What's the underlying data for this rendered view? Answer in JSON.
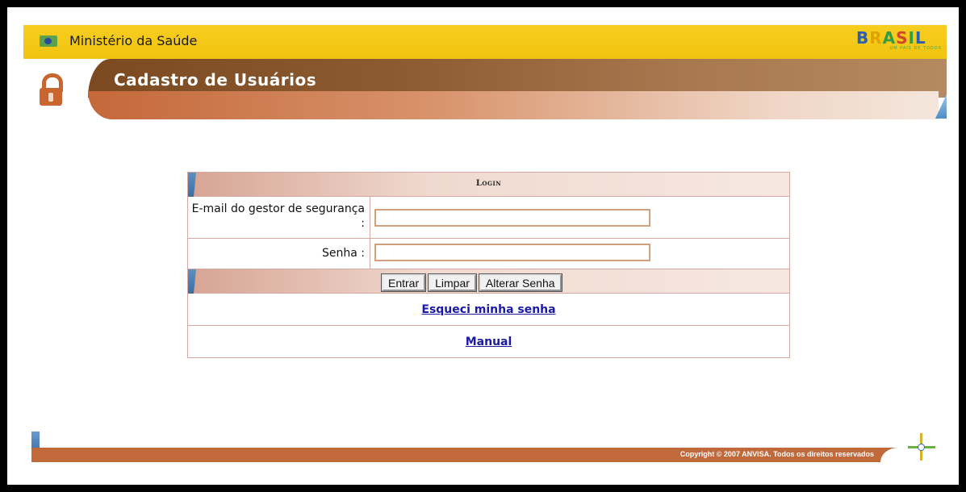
{
  "header": {
    "ministry": "Ministério da Saúde",
    "brand_letters": "BRASIL",
    "brand_tagline": "UM PAÍS DE TODOS",
    "page_title": "Cadastro de Usuários"
  },
  "login": {
    "title": "Login",
    "email_label": "E-mail do gestor de segurança :",
    "email_value": "",
    "password_label": "Senha :",
    "password_value": "",
    "buttons": {
      "submit": "Entrar",
      "clear": "Limpar",
      "change_password": "Alterar Senha"
    },
    "forgot_link": "Esqueci minha senha",
    "manual_link": "Manual"
  },
  "footer": {
    "copyright": "Copyright © 2007 ANVISA. Todos os direitos reservados"
  },
  "colors": {
    "topbar": "#f1c40f",
    "header_brown": "#8c5a30",
    "accent_orange": "#c1693b",
    "accent_blue": "#3b6ea5",
    "link": "#1a1aa6"
  },
  "icons": {
    "gov": "brazil-flag-icon",
    "lock": "padlock-icon",
    "anvisa": "anvisa-logo-icon"
  }
}
